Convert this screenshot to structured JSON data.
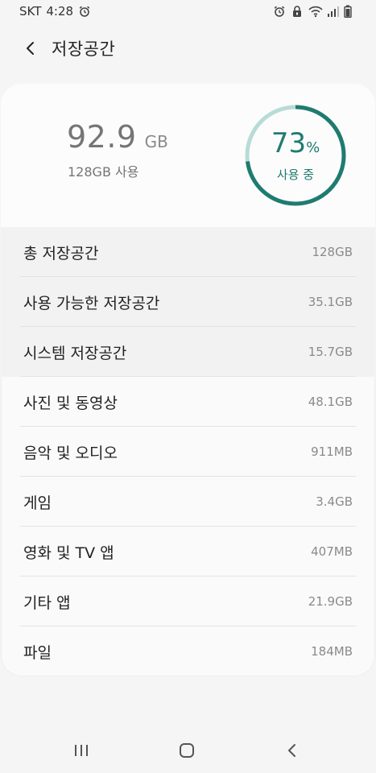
{
  "status_bar": {
    "carrier": "SKT",
    "time": "4:28"
  },
  "header": {
    "title": "저장공간"
  },
  "summary": {
    "used_value": "92.9",
    "used_unit": "GB",
    "total_caption": "128GB 사용",
    "gauge": {
      "percent": "73",
      "percent_sign": "%",
      "caption": "사용 중",
      "fraction": 0.73,
      "color": "#1f7b70"
    }
  },
  "rows": [
    {
      "label": "총 저장공간",
      "value": "128GB"
    },
    {
      "label": "사용 가능한 저장공간",
      "value": "35.1GB"
    },
    {
      "label": "시스템 저장공간",
      "value": "15.7GB"
    },
    {
      "label": "사진 및 동영상",
      "value": "48.1GB"
    },
    {
      "label": "음악 및 오디오",
      "value": "911MB"
    },
    {
      "label": "게임",
      "value": "3.4GB"
    },
    {
      "label": "영화 및 TV 앱",
      "value": "407MB"
    },
    {
      "label": "기타 앱",
      "value": "21.9GB"
    },
    {
      "label": "파일",
      "value": "184MB"
    }
  ],
  "icons": {
    "alarm": "alarm-icon",
    "wifi": "wifi-icon",
    "signal": "signal-icon",
    "back": "back-arrow-icon",
    "recents": "recents-icon",
    "home": "home-icon",
    "nav_back": "nav-back-icon"
  }
}
